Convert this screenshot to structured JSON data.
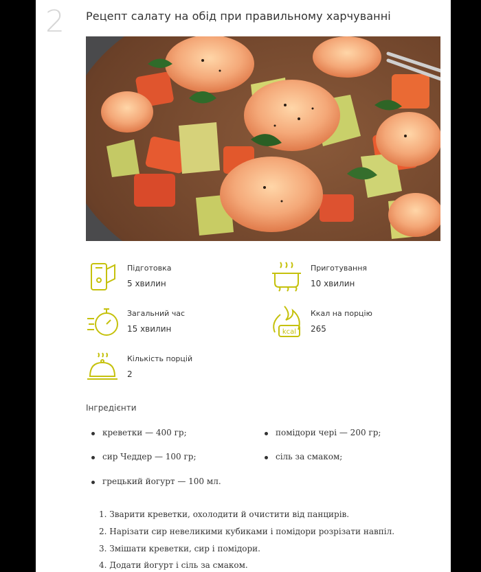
{
  "recipe": {
    "number": "2",
    "title": "Рецепт салату на обід при правильному харчуванні"
  },
  "info": [
    {
      "label": "Підготовка",
      "value": "5 хвилин",
      "icon": "prep-board-icon"
    },
    {
      "label": "Приготування",
      "value": "10 хвилин",
      "icon": "cooking-pot-icon"
    },
    {
      "label": "Загальний час",
      "value": "15 хвилин",
      "icon": "stopwatch-icon"
    },
    {
      "label": "Ккал на порцію",
      "value": "265",
      "icon": "kcal-flame-icon",
      "icon_text": "kcal"
    },
    {
      "label": "Кількість порцій",
      "value": "2",
      "icon": "cloche-icon"
    }
  ],
  "ingredients_heading": "Інгредієнти",
  "ingredients": [
    "креветки — 400 гр;",
    "помідори чері — 200 гр;",
    "сир Чеддер — 100 гр;",
    "сіль за смаком;",
    "грецький йогурт — 100 мл."
  ],
  "steps": [
    "1. Зварити креветки, охолодити й очистити від панцирів.",
    "2. Нарізати сир невеликими кубиками і помідори розрізати навпіл.",
    "3. Змішати креветки, сир і помідори.",
    "4. Додати йогурт і сіль за смаком."
  ],
  "colors": {
    "accent": "#c5c10c",
    "page": "#ffffff",
    "backdrop": "#000000"
  }
}
